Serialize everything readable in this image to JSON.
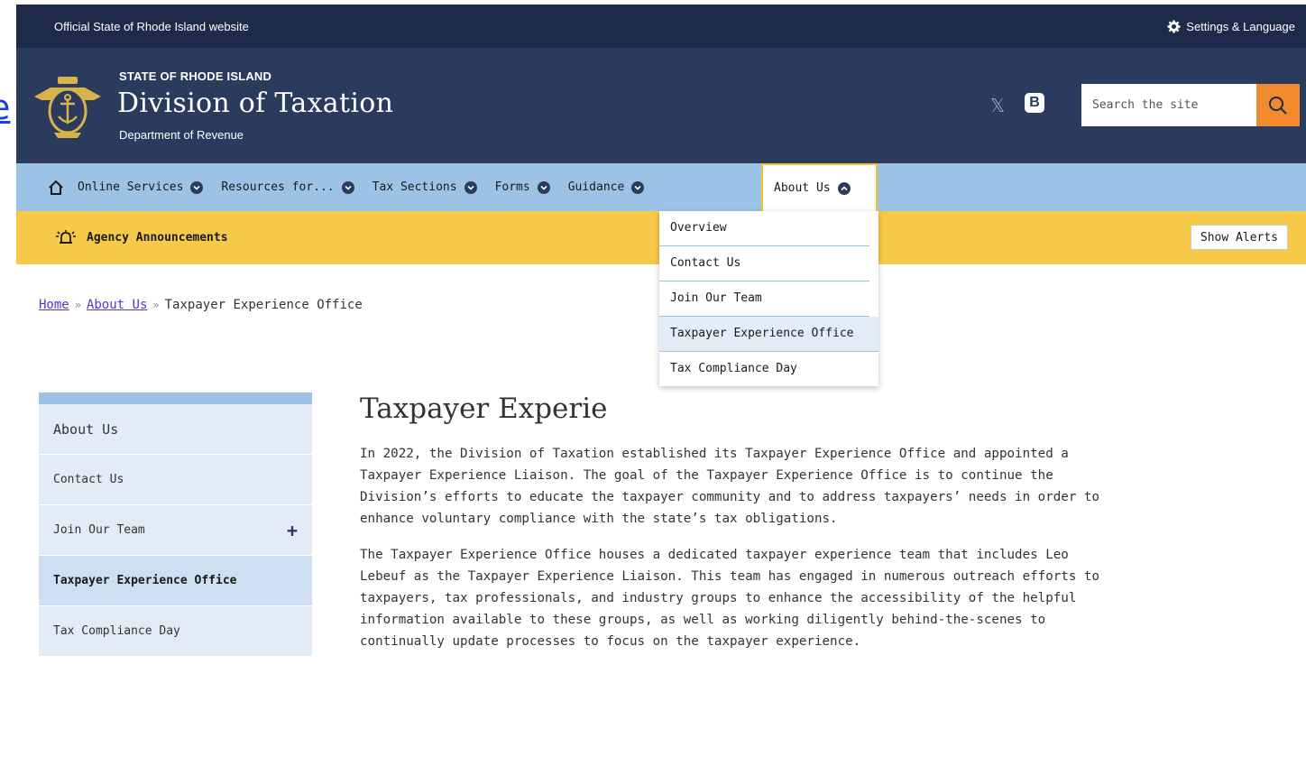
{
  "left_fragment": {
    "text": "e"
  },
  "topbar": {
    "official_text": "Official State of Rhode Island website",
    "settings_label": "Settings & Language"
  },
  "header": {
    "kicker": "STATE OF RHODE ISLAND",
    "title": "Division of Taxation",
    "subtitle": "Department of Revenue",
    "social": {
      "x_icon": "x-logo-icon",
      "blogger_icon": "blogger-icon",
      "x_glyph": "𝕏",
      "b_glyph": "B"
    },
    "search": {
      "placeholder": "Search the site"
    },
    "accent": "#f08a2c"
  },
  "nav": {
    "items": [
      {
        "label": "Online Services"
      },
      {
        "label": "Resources for..."
      },
      {
        "label": "Tax Sections"
      },
      {
        "label": "Forms"
      },
      {
        "label": "Guidance"
      }
    ],
    "active": {
      "label": "About Us"
    }
  },
  "alerts": {
    "label": "Agency Announcements",
    "button": "Show Alerts"
  },
  "dropdown": {
    "items": [
      {
        "label": "Overview"
      },
      {
        "label": "Contact Us"
      },
      {
        "label": "Join Our Team"
      },
      {
        "label": "Taxpayer Experience Office"
      },
      {
        "label": "Tax Compliance Day"
      }
    ]
  },
  "breadcrumb": {
    "home": "Home",
    "about": "About Us",
    "current": "Taxpayer Experience Office",
    "separator": "»"
  },
  "sidenav": {
    "items": [
      {
        "label": "About Us"
      },
      {
        "label": "Contact Us"
      },
      {
        "label": "Join Our Team"
      },
      {
        "label": "Taxpayer Experience Office"
      },
      {
        "label": "Tax Compliance Day"
      }
    ],
    "expand_glyph": "+"
  },
  "content": {
    "title": "Taxpayer Experie",
    "paragraphs": [
      "In 2022, the Division of Taxation established its Taxpayer Experience Office and appointed a Taxpayer Experience Liaison.  The goal of the Taxpayer Experience Office is to continue the Division’s efforts to educate the taxpayer community and to address taxpayers’ needs in order to enhance voluntary compliance with the state’s tax obligations.",
      "The Taxpayer Experience Office houses a dedicated taxpayer experience team that includes Leo Lebeuf as the Taxpayer Experience Liaison.  This team has engaged in numerous outreach efforts to taxpayers, tax professionals, and industry groups to enhance the accessibility of the helpful information available to these groups, as well as working diligently behind-the-scenes to continually update processes to focus on the taxpayer experience."
    ]
  }
}
